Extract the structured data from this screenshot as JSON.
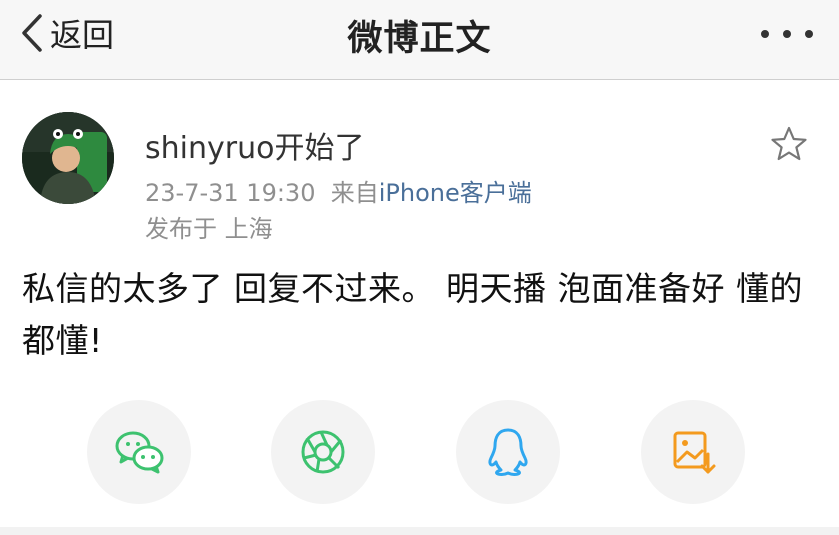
{
  "nav": {
    "back_label": "返回",
    "title": "微博正文",
    "more_icon": "more-dots-icon"
  },
  "post": {
    "username": "shinyruo开始了",
    "timestamp": "23-7-31 19:30",
    "source_prefix": "来自",
    "source": "iPhone客户端",
    "location": "发布于 上海",
    "content": "私信的太多了 回复不过来。 明天播 泡面准备好 懂的都懂!"
  },
  "share_targets": [
    {
      "icon": "wechat-icon",
      "color": "#3dc26f"
    },
    {
      "icon": "moments-icon",
      "color": "#3dc26f"
    },
    {
      "icon": "qq-icon",
      "color": "#2fa7ef"
    },
    {
      "icon": "save-image-icon",
      "color": "#f39a1e"
    }
  ],
  "colors": {
    "nav_bg": "#f7f7f7",
    "link": "#4a6f99",
    "meta": "#8f8f8f"
  }
}
